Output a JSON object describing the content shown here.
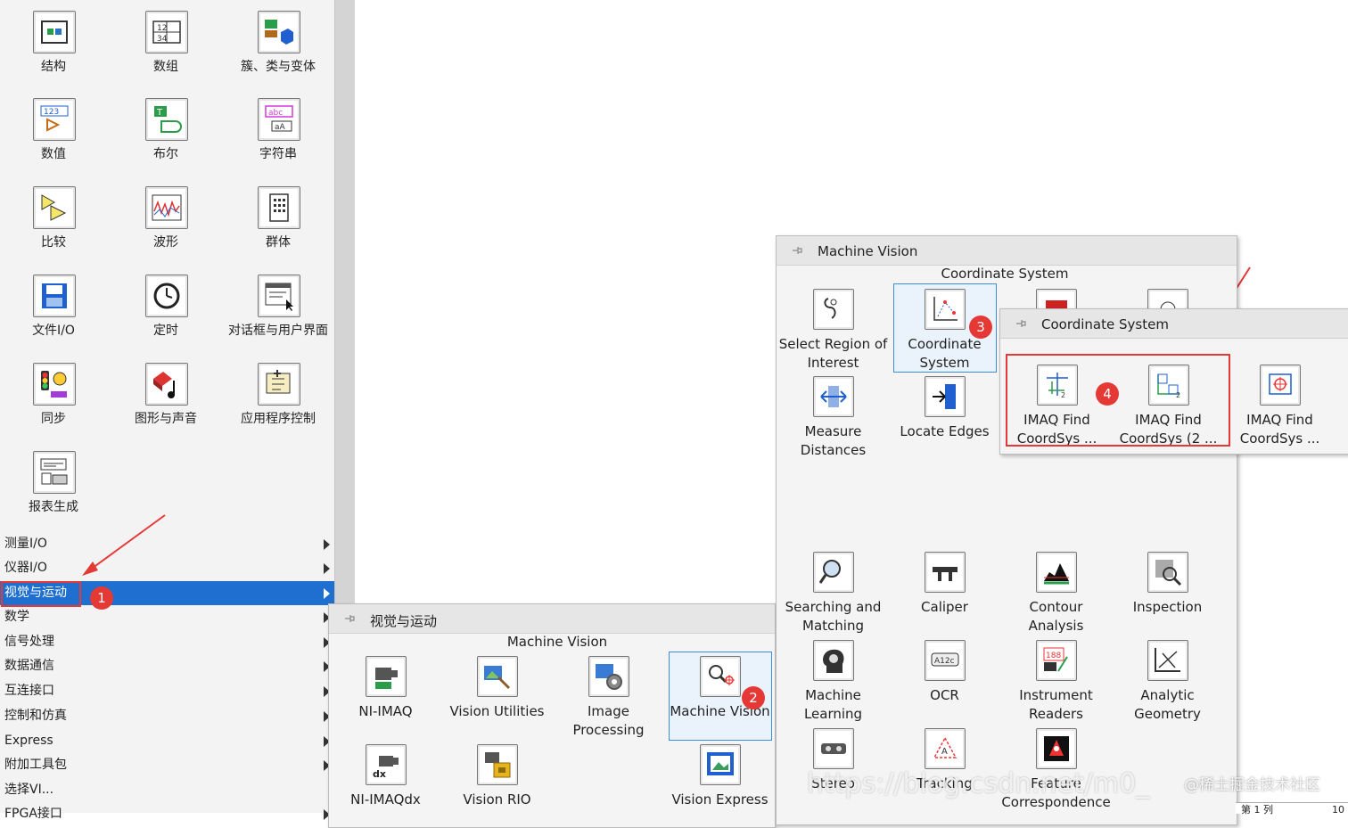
{
  "palette": {
    "items": [
      {
        "label": "结构",
        "icon": "structure-icon"
      },
      {
        "label": "数组",
        "icon": "array-icon"
      },
      {
        "label": "簇、类与变体",
        "icon": "cluster-icon"
      },
      {
        "label": "数值",
        "icon": "numeric-icon"
      },
      {
        "label": "布尔",
        "icon": "boolean-icon"
      },
      {
        "label": "字符串",
        "icon": "string-icon"
      },
      {
        "label": "比较",
        "icon": "comparison-icon"
      },
      {
        "label": "波形",
        "icon": "waveform-icon"
      },
      {
        "label": "群体",
        "icon": "group-icon"
      },
      {
        "label": "文件I/O",
        "icon": "file-io-icon"
      },
      {
        "label": "定时",
        "icon": "timing-icon"
      },
      {
        "label": "对话框与用户界面",
        "icon": "dialog-icon"
      },
      {
        "label": "同步",
        "icon": "sync-icon"
      },
      {
        "label": "图形与声音",
        "icon": "graphics-sound-icon"
      },
      {
        "label": "应用程序控制",
        "icon": "app-control-icon"
      },
      {
        "label": "报表生成",
        "icon": "report-icon"
      }
    ],
    "categories": [
      "测量I/O",
      "仪器I/O",
      "视觉与运动",
      "数学",
      "信号处理",
      "数据通信",
      "互连接口",
      "控制和仿真",
      "Express",
      "附加工具包",
      "选择VI...",
      "FPGA接口"
    ],
    "selected_category": "视觉与运动"
  },
  "vision_motion_panel": {
    "title": "视觉与运动",
    "section": "Machine Vision",
    "items": [
      {
        "label": "NI-IMAQ"
      },
      {
        "label": "Vision Utilities"
      },
      {
        "label": "Image Processing"
      },
      {
        "label": "Machine Vision"
      },
      {
        "label": "NI-IMAQdx"
      },
      {
        "label": "Vision RIO"
      },
      {
        "label": "Vision Express"
      }
    ]
  },
  "machine_vision_panel": {
    "title": "Machine Vision",
    "section": "Coordinate System",
    "items": [
      {
        "label": "Select Region of Interest"
      },
      {
        "label": "Coordinate System"
      },
      {
        "label": "Measure Distances"
      },
      {
        "label": "Locate Edges"
      },
      {
        "label": "Searching and Matching"
      },
      {
        "label": "Caliper"
      },
      {
        "label": "Contour Analysis"
      },
      {
        "label": "Inspection"
      },
      {
        "label": "Machine Learning"
      },
      {
        "label": "OCR"
      },
      {
        "label": "Instrument Readers"
      },
      {
        "label": "Analytic Geometry"
      },
      {
        "label": "Stereo"
      },
      {
        "label": "Tracking"
      },
      {
        "label": "Feature Correspondence"
      }
    ]
  },
  "coordinate_panel": {
    "title": "Coordinate System",
    "items": [
      {
        "label": "IMAQ Find CoordSys ..."
      },
      {
        "label": "IMAQ Find CoordSys (2 ..."
      },
      {
        "label": "IMAQ Find CoordSys ..."
      }
    ]
  },
  "annotations": {
    "badges": [
      "1",
      "2",
      "3",
      "4"
    ],
    "accent": "#e53935",
    "selection": "#1e6fcf"
  },
  "watermark": {
    "url": "https://blog.csdn.net/m0_",
    "site": "@稀土掘金技术社区"
  },
  "status": {
    "cell": "第 1 列",
    "num": "10"
  }
}
